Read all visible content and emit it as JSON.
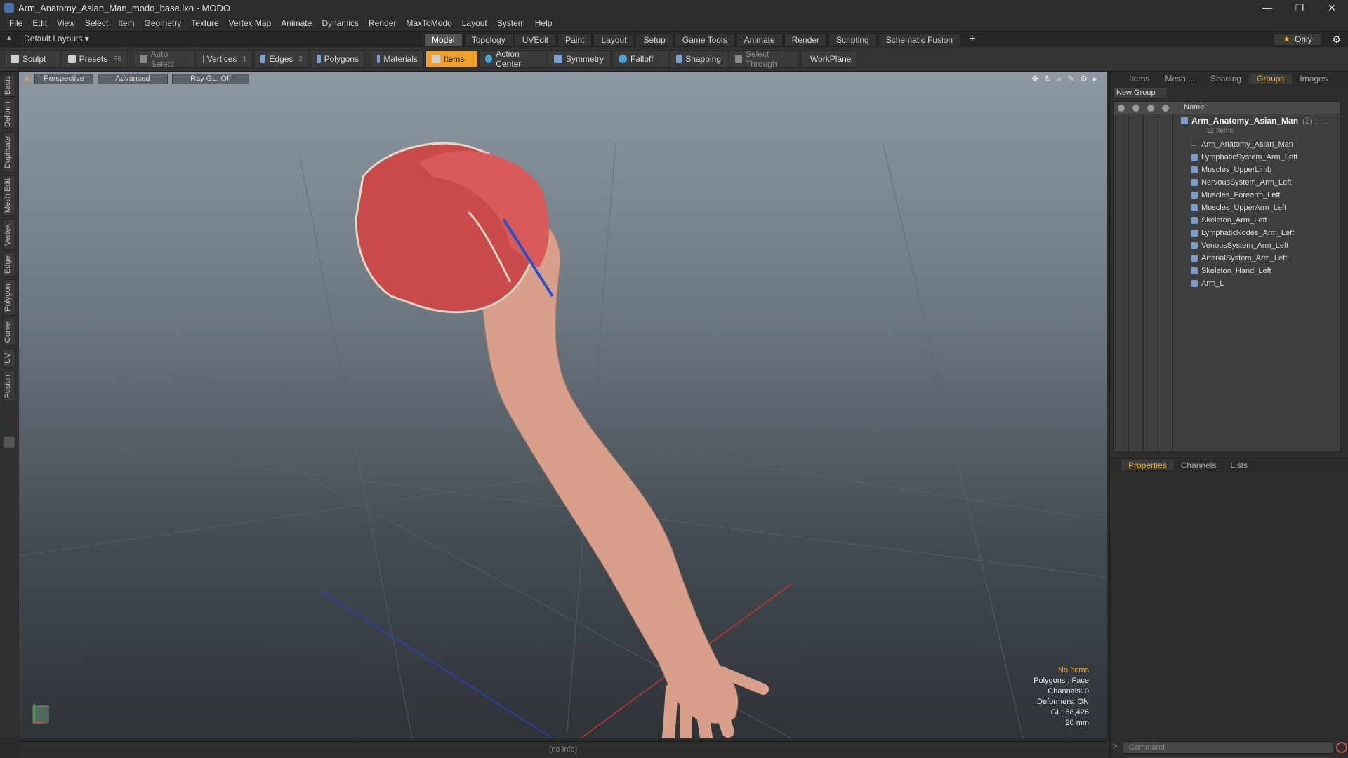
{
  "window": {
    "title": "Arm_Anatomy_Asian_Man_modo_base.lxo - MODO",
    "controls": [
      "—",
      "❐",
      "✕"
    ]
  },
  "menu": [
    "File",
    "Edit",
    "View",
    "Select",
    "Item",
    "Geometry",
    "Texture",
    "Vertex Map",
    "Animate",
    "Dynamics",
    "Render",
    "MaxToModo",
    "Layout",
    "System",
    "Help"
  ],
  "layoutbar": {
    "layout": "Default Layouts ▾",
    "tabs": [
      "Model",
      "Topology",
      "UVEdit",
      "Paint",
      "Layout",
      "Setup",
      "Game Tools",
      "Animate",
      "Render",
      "Scripting",
      "Schematic Fusion"
    ],
    "active_tab": "Model",
    "plus": "+",
    "only": "Only"
  },
  "toolbar": {
    "sculpt": "Sculpt",
    "presets": "Presets",
    "presets_key": "F6",
    "auto_select": "Auto Select",
    "vertices": "Vertices",
    "vertices_key": "1",
    "edges": "Edges",
    "edges_key": "2",
    "polygons": "Polygons",
    "materials": "Materials",
    "items": "Items",
    "action_center": "Action Center",
    "symmetry": "Symmetry",
    "falloff": "Falloff",
    "snapping": "Snapping",
    "select_through": "Select Through",
    "workplane": "WorkPlane"
  },
  "left_tabs": [
    "Basic",
    "Deform",
    "Duplicate",
    "Mesh Edit",
    "Vertex",
    "Edge",
    "Polygon",
    "Curve",
    "UV",
    "Fusion"
  ],
  "viewport": {
    "view": "Perspective",
    "shading": "Advanced",
    "raygl": "Ray GL: Off",
    "info": {
      "selection": "No Items",
      "polygons": "Polygons : Face",
      "channels": "Channels: 0",
      "deformers": "Deformers: ON",
      "gl": "GL: 88,426",
      "size": "20 mm"
    }
  },
  "right_panel": {
    "tabs": [
      "Items",
      "Mesh ...",
      "Shading",
      "Groups",
      "Images"
    ],
    "active_tab": "Groups",
    "new_group": "New Group",
    "column_name": "Name",
    "group_name": "Arm_Anatomy_Asian_Man",
    "group_count": "(2) : ...",
    "group_sub": "12 Items",
    "items": [
      "Arm_Anatomy_Asian_Man",
      "LymphaticSystem_Arm_Left",
      "Muscles_UpperLimb",
      "NervousSystem_Arm_Left",
      "Muscles_Forearm_Left",
      "Muscles_UpperArm_Left",
      "Skeleton_Arm_Left",
      "LymphaticNodes_Arm_Left",
      "VenousSystem_Arm_Left",
      "ArterialSystem_Arm_Left",
      "Skeleton_Hand_Left",
      "Arm_L"
    ],
    "bottom_tabs": [
      "Properties",
      "Channels",
      "Lists"
    ],
    "bottom_active": "Properties",
    "command_placeholder": "Command"
  },
  "status": "(no info)",
  "colors": {
    "accent": "#f0b429",
    "active_tool": "#f0a026",
    "skin": "#d9a08a",
    "muscle": "#c94a4a"
  }
}
